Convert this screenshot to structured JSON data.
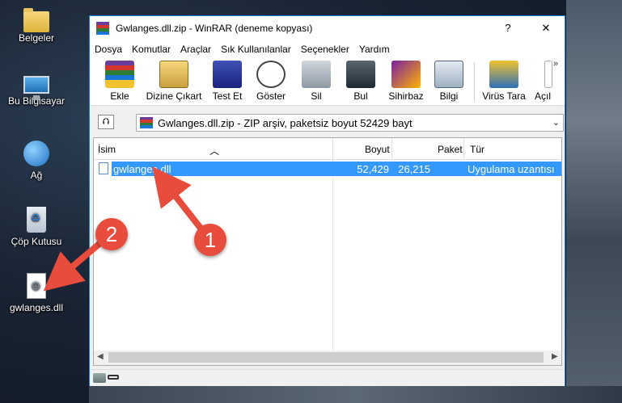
{
  "desktop": {
    "icons": [
      {
        "label": "Belgeler"
      },
      {
        "label": "Bu Bilgisayar"
      },
      {
        "label": "Ağ"
      },
      {
        "label": "Çöp Kutusu"
      },
      {
        "label": "gwlanges.dll"
      }
    ]
  },
  "window": {
    "title": "Gwlanges.dll.zip - WinRAR (deneme kopyası)",
    "help_glyph": "?",
    "close_glyph": "✕"
  },
  "menu": {
    "items": [
      "Dosya",
      "Komutlar",
      "Araçlar",
      "Sık Kullanılanlar",
      "Seçenekler",
      "Yardım"
    ]
  },
  "toolbar": {
    "buttons": [
      {
        "label": "Ekle",
        "icon": "add-archive-icon"
      },
      {
        "label": "Dizine Çıkart",
        "icon": "extract-to-icon"
      },
      {
        "label": "Test Et",
        "icon": "test-icon"
      },
      {
        "label": "Göster",
        "icon": "view-icon"
      },
      {
        "label": "Sil",
        "icon": "delete-icon"
      },
      {
        "label": "Bul",
        "icon": "find-icon"
      },
      {
        "label": "Sihirbaz",
        "icon": "wizard-icon"
      },
      {
        "label": "Bilgi",
        "icon": "info-icon"
      },
      {
        "label": "Virüs Tara",
        "icon": "virus-scan-icon"
      },
      {
        "label": "Açıl",
        "icon": "comment-icon"
      }
    ],
    "overflow_glyph": "»"
  },
  "address": {
    "path": "Gwlanges.dll.zip - ZIP arşiv, paketsiz boyut 52429 bayt",
    "up_glyph": "⮉",
    "dropdown_glyph": "⌄"
  },
  "list": {
    "columns": [
      "İsim",
      "Boyut",
      "Paket",
      "Tür"
    ],
    "rows": [
      {
        "name": "gwlanges.dll",
        "size": "52,429",
        "packed": "26,215",
        "type": "Uygulama uzantısı"
      }
    ]
  },
  "scrollbar": {
    "left_glyph": "◀",
    "right_glyph": "▶"
  },
  "annotations": [
    {
      "number": "1"
    },
    {
      "number": "2"
    }
  ],
  "colors": {
    "accent": "#1883d7",
    "selection": "#3399ff",
    "annotation": "#e74c3c"
  }
}
